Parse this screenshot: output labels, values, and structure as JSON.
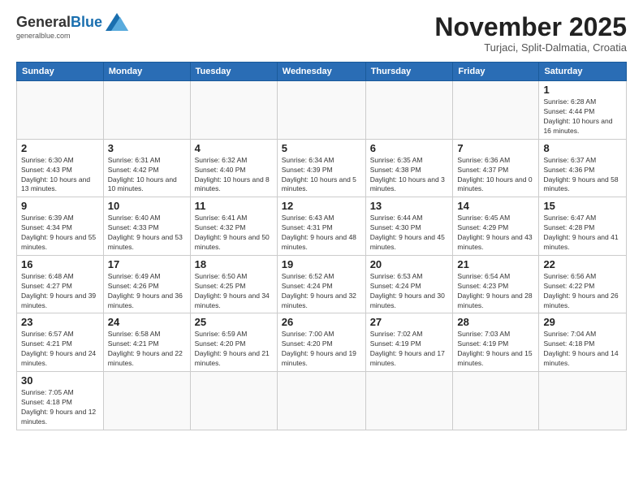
{
  "logo": {
    "general": "General",
    "blue": "Blue",
    "tagline": "generalblue.com"
  },
  "header": {
    "month": "November 2025",
    "location": "Turjaci, Split-Dalmatia, Croatia"
  },
  "weekdays": [
    "Sunday",
    "Monday",
    "Tuesday",
    "Wednesday",
    "Thursday",
    "Friday",
    "Saturday"
  ],
  "weeks": [
    [
      {
        "day": "",
        "info": ""
      },
      {
        "day": "",
        "info": ""
      },
      {
        "day": "",
        "info": ""
      },
      {
        "day": "",
        "info": ""
      },
      {
        "day": "",
        "info": ""
      },
      {
        "day": "",
        "info": ""
      },
      {
        "day": "1",
        "info": "Sunrise: 6:28 AM\nSunset: 4:44 PM\nDaylight: 10 hours and 16 minutes."
      }
    ],
    [
      {
        "day": "2",
        "info": "Sunrise: 6:30 AM\nSunset: 4:43 PM\nDaylight: 10 hours and 13 minutes."
      },
      {
        "day": "3",
        "info": "Sunrise: 6:31 AM\nSunset: 4:42 PM\nDaylight: 10 hours and 10 minutes."
      },
      {
        "day": "4",
        "info": "Sunrise: 6:32 AM\nSunset: 4:40 PM\nDaylight: 10 hours and 8 minutes."
      },
      {
        "day": "5",
        "info": "Sunrise: 6:34 AM\nSunset: 4:39 PM\nDaylight: 10 hours and 5 minutes."
      },
      {
        "day": "6",
        "info": "Sunrise: 6:35 AM\nSunset: 4:38 PM\nDaylight: 10 hours and 3 minutes."
      },
      {
        "day": "7",
        "info": "Sunrise: 6:36 AM\nSunset: 4:37 PM\nDaylight: 10 hours and 0 minutes."
      },
      {
        "day": "8",
        "info": "Sunrise: 6:37 AM\nSunset: 4:36 PM\nDaylight: 9 hours and 58 minutes."
      }
    ],
    [
      {
        "day": "9",
        "info": "Sunrise: 6:39 AM\nSunset: 4:34 PM\nDaylight: 9 hours and 55 minutes."
      },
      {
        "day": "10",
        "info": "Sunrise: 6:40 AM\nSunset: 4:33 PM\nDaylight: 9 hours and 53 minutes."
      },
      {
        "day": "11",
        "info": "Sunrise: 6:41 AM\nSunset: 4:32 PM\nDaylight: 9 hours and 50 minutes."
      },
      {
        "day": "12",
        "info": "Sunrise: 6:43 AM\nSunset: 4:31 PM\nDaylight: 9 hours and 48 minutes."
      },
      {
        "day": "13",
        "info": "Sunrise: 6:44 AM\nSunset: 4:30 PM\nDaylight: 9 hours and 45 minutes."
      },
      {
        "day": "14",
        "info": "Sunrise: 6:45 AM\nSunset: 4:29 PM\nDaylight: 9 hours and 43 minutes."
      },
      {
        "day": "15",
        "info": "Sunrise: 6:47 AM\nSunset: 4:28 PM\nDaylight: 9 hours and 41 minutes."
      }
    ],
    [
      {
        "day": "16",
        "info": "Sunrise: 6:48 AM\nSunset: 4:27 PM\nDaylight: 9 hours and 39 minutes."
      },
      {
        "day": "17",
        "info": "Sunrise: 6:49 AM\nSunset: 4:26 PM\nDaylight: 9 hours and 36 minutes."
      },
      {
        "day": "18",
        "info": "Sunrise: 6:50 AM\nSunset: 4:25 PM\nDaylight: 9 hours and 34 minutes."
      },
      {
        "day": "19",
        "info": "Sunrise: 6:52 AM\nSunset: 4:24 PM\nDaylight: 9 hours and 32 minutes."
      },
      {
        "day": "20",
        "info": "Sunrise: 6:53 AM\nSunset: 4:24 PM\nDaylight: 9 hours and 30 minutes."
      },
      {
        "day": "21",
        "info": "Sunrise: 6:54 AM\nSunset: 4:23 PM\nDaylight: 9 hours and 28 minutes."
      },
      {
        "day": "22",
        "info": "Sunrise: 6:56 AM\nSunset: 4:22 PM\nDaylight: 9 hours and 26 minutes."
      }
    ],
    [
      {
        "day": "23",
        "info": "Sunrise: 6:57 AM\nSunset: 4:21 PM\nDaylight: 9 hours and 24 minutes."
      },
      {
        "day": "24",
        "info": "Sunrise: 6:58 AM\nSunset: 4:21 PM\nDaylight: 9 hours and 22 minutes."
      },
      {
        "day": "25",
        "info": "Sunrise: 6:59 AM\nSunset: 4:20 PM\nDaylight: 9 hours and 21 minutes."
      },
      {
        "day": "26",
        "info": "Sunrise: 7:00 AM\nSunset: 4:20 PM\nDaylight: 9 hours and 19 minutes."
      },
      {
        "day": "27",
        "info": "Sunrise: 7:02 AM\nSunset: 4:19 PM\nDaylight: 9 hours and 17 minutes."
      },
      {
        "day": "28",
        "info": "Sunrise: 7:03 AM\nSunset: 4:19 PM\nDaylight: 9 hours and 15 minutes."
      },
      {
        "day": "29",
        "info": "Sunrise: 7:04 AM\nSunset: 4:18 PM\nDaylight: 9 hours and 14 minutes."
      }
    ],
    [
      {
        "day": "30",
        "info": "Sunrise: 7:05 AM\nSunset: 4:18 PM\nDaylight: 9 hours and 12 minutes."
      },
      {
        "day": "",
        "info": ""
      },
      {
        "day": "",
        "info": ""
      },
      {
        "day": "",
        "info": ""
      },
      {
        "day": "",
        "info": ""
      },
      {
        "day": "",
        "info": ""
      },
      {
        "day": "",
        "info": ""
      }
    ]
  ]
}
